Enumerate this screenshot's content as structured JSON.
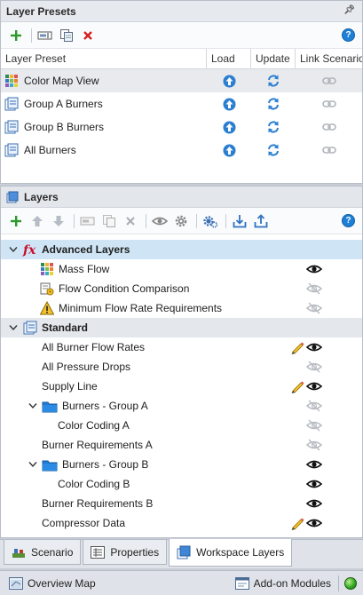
{
  "presets": {
    "title": "Layer Presets",
    "columns": [
      "Layer Preset",
      "Load",
      "Update",
      "Link Scenario"
    ],
    "rows": [
      {
        "name": "Color Map View",
        "icon": "colormap-icon",
        "selected": true
      },
      {
        "name": "Group A Burners",
        "icon": "layer-doc-icon",
        "selected": false
      },
      {
        "name": "Group B Burners",
        "icon": "layer-doc-icon",
        "selected": false
      },
      {
        "name": "All Burners",
        "icon": "layer-doc-icon",
        "selected": false
      }
    ]
  },
  "layers": {
    "title": "Layers",
    "groups": [
      {
        "label": "Advanced Layers",
        "icon": "fx-icon",
        "items": [
          {
            "label": "Mass Flow",
            "icon": "colormap-icon",
            "visible": true,
            "pencil": false
          },
          {
            "label": "Flow Condition Comparison",
            "icon": "comparison-icon",
            "visible": false,
            "pencil": false
          },
          {
            "label": "Minimum Flow Rate Requirements",
            "icon": "warning-icon",
            "visible": false,
            "pencil": false
          }
        ]
      },
      {
        "label": "Standard",
        "icon": "layer-doc-icon",
        "items": [
          {
            "label": "All Burner Flow Rates",
            "visible": true,
            "pencil": true
          },
          {
            "label": "All Pressure Drops",
            "visible": false,
            "pencil": false
          },
          {
            "label": "Supply Line",
            "visible": true,
            "pencil": true
          },
          {
            "label": "Burners - Group A",
            "folder": true,
            "visible": false,
            "pencil": false
          },
          {
            "label": "Color Coding A",
            "sub": true,
            "visible": false,
            "pencil": false
          },
          {
            "label": "Burner Requirements A",
            "visible": false,
            "pencil": false
          },
          {
            "label": "Burners - Group B",
            "folder": true,
            "visible": true,
            "pencil": false
          },
          {
            "label": "Color Coding B",
            "sub": true,
            "visible": true,
            "pencil": false
          },
          {
            "label": "Burner Requirements B",
            "visible": true,
            "pencil": false
          },
          {
            "label": "Compressor Data",
            "visible": true,
            "pencil": true
          }
        ]
      }
    ]
  },
  "tabs": [
    {
      "label": "Scenario",
      "icon": "scenario-icon",
      "active": false
    },
    {
      "label": "Properties",
      "icon": "properties-icon",
      "active": false
    },
    {
      "label": "Workspace Layers",
      "icon": "layers-icon",
      "active": true
    }
  ],
  "status": {
    "overview": "Overview Map",
    "addon": "Add-on Modules"
  },
  "colors": {
    "accent_blue": "#1e7fd6",
    "highlight": "#cfe5f6",
    "add_green": "#2b9a2b",
    "delete_red": "#d32020",
    "pencil_yellow": "#f2c12e"
  }
}
